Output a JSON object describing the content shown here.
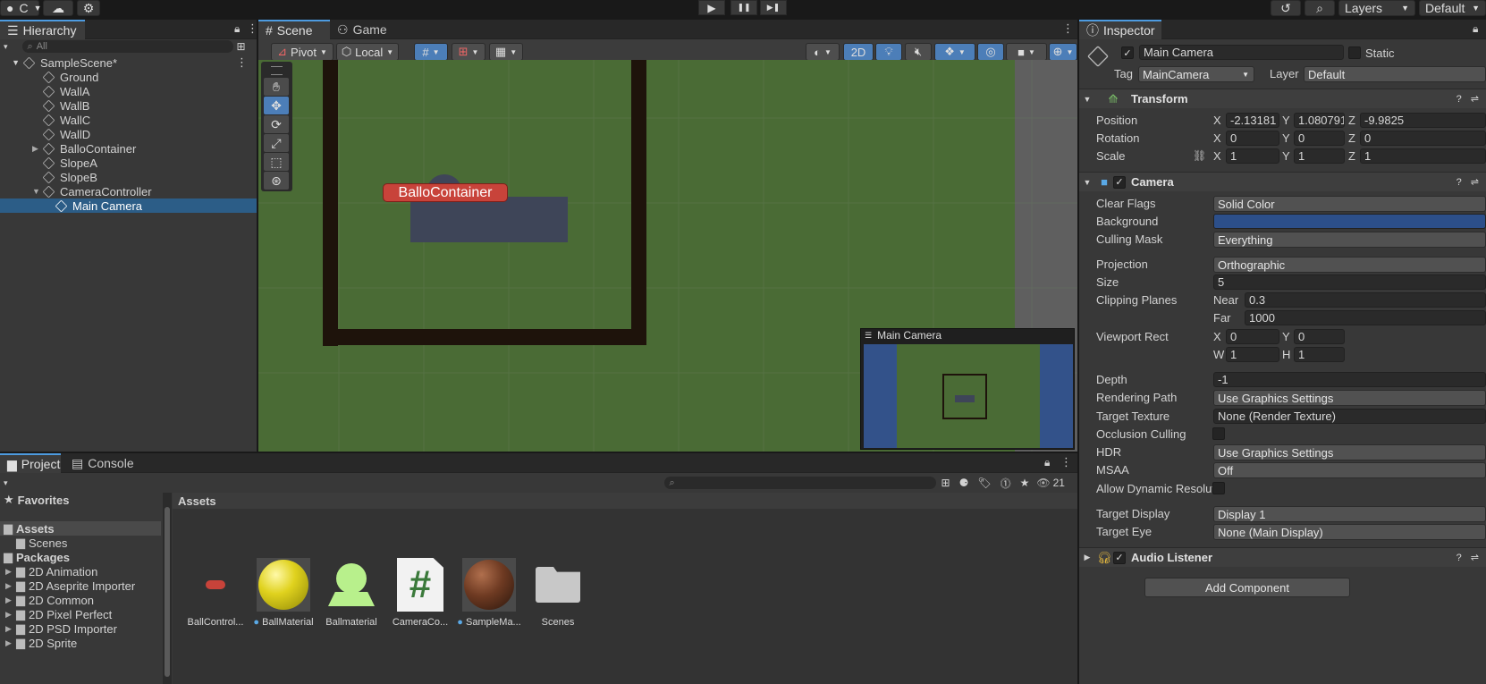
{
  "toolbar": {
    "account_label": "C",
    "layers_label": "Layers",
    "layout_label": "Default"
  },
  "play_controls": {
    "play": "▶",
    "pause": "❚❚",
    "step": "▶❚"
  },
  "hierarchy": {
    "tab_label": "Hierarchy",
    "search_placeholder": "All",
    "scene_name": "SampleScene*",
    "items": [
      {
        "label": "Ground"
      },
      {
        "label": "WallA"
      },
      {
        "label": "WallB"
      },
      {
        "label": "WallC"
      },
      {
        "label": "WallD"
      },
      {
        "label": "BalloContainer"
      },
      {
        "label": "SlopeA"
      },
      {
        "label": "SlopeB"
      },
      {
        "label": "CameraController"
      },
      {
        "label": "Main Camera"
      }
    ]
  },
  "scene": {
    "tabs": [
      {
        "label": "Scene"
      },
      {
        "label": "Game"
      }
    ],
    "pivot_label": "Pivot",
    "local_label": "Local",
    "mode_2d_label": "2D",
    "object_label": "BalloContainer",
    "camera_preview_title": "Main Camera"
  },
  "inspector": {
    "tab_label": "Inspector",
    "object_name": "Main Camera",
    "static_label": "Static",
    "tag_label": "Tag",
    "tag_value": "MainCamera",
    "layer_label": "Layer",
    "layer_value": "Default",
    "transform": {
      "title": "Transform",
      "position_label": "Position",
      "rotation_label": "Rotation",
      "scale_label": "Scale",
      "position": {
        "x": "-2.13181",
        "y": "1.080791",
        "z": "-9.9825"
      },
      "rotation": {
        "x": "0",
        "y": "0",
        "z": "0"
      },
      "scale": {
        "x": "1",
        "y": "1",
        "z": "1"
      }
    },
    "camera": {
      "title": "Camera",
      "clear_flags_label": "Clear Flags",
      "clear_flags": "Solid Color",
      "background_label": "Background",
      "background_color": "#2c4f8a",
      "culling_mask_label": "Culling Mask",
      "culling_mask": "Everything",
      "projection_label": "Projection",
      "projection": "Orthographic",
      "size_label": "Size",
      "size": "5",
      "clipping_label": "Clipping Planes",
      "near_label": "Near",
      "near": "0.3",
      "far_label": "Far",
      "far": "1000",
      "viewport_label": "Viewport Rect",
      "vx": "0",
      "vy": "0",
      "vw": "1",
      "vh": "1",
      "depth_label": "Depth",
      "depth": "-1",
      "rendering_path_label": "Rendering Path",
      "rendering_path": "Use Graphics Settings",
      "target_texture_label": "Target Texture",
      "target_texture": "None (Render Texture)",
      "occlusion_label": "Occlusion Culling",
      "hdr_label": "HDR",
      "hdr": "Use Graphics Settings",
      "msaa_label": "MSAA",
      "msaa": "Off",
      "dynamic_res_label": "Allow Dynamic Resolut",
      "target_display_label": "Target Display",
      "target_display": "Display 1",
      "target_eye_label": "Target Eye",
      "target_eye": "None (Main Display)"
    },
    "audio_listener_title": "Audio Listener",
    "add_component_label": "Add Component"
  },
  "project": {
    "tabs": [
      {
        "label": "Project"
      },
      {
        "label": "Console"
      }
    ],
    "hidden_count": "21",
    "favorites_label": "Favorites",
    "assets_label": "Assets",
    "scenes_label": "Scenes",
    "packages_label": "Packages",
    "packages": [
      {
        "label": "2D Animation"
      },
      {
        "label": "2D Aseprite Importer"
      },
      {
        "label": "2D Common"
      },
      {
        "label": "2D Pixel Perfect"
      },
      {
        "label": "2D PSD Importer"
      },
      {
        "label": "2D Sprite"
      }
    ],
    "breadcrumb": "Assets",
    "assets": [
      {
        "label": "BallControl..."
      },
      {
        "label": "BallMaterial"
      },
      {
        "label": "Ballmaterial"
      },
      {
        "label": "CameraCo..."
      },
      {
        "label": "SampleMa..."
      },
      {
        "label": "Scenes"
      }
    ]
  },
  "icons": {
    "cloud": "cloud-icon",
    "settings": "gear-icon",
    "history": "history-icon",
    "search": "search-icon",
    "lock": "lock-icon",
    "menu": "kebab-menu-icon",
    "help": "help-icon",
    "preset": "preset-icon",
    "hand": "hand-tool-icon",
    "move": "move-tool-icon",
    "rotate": "rotate-tool-icon",
    "scale": "scale-tool-icon",
    "rect": "rect-tool-icon",
    "transform": "transform-tool-icon"
  }
}
